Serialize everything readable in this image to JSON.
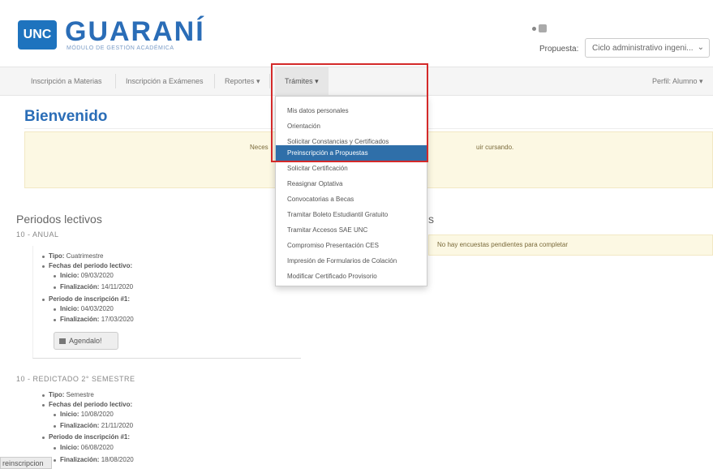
{
  "header": {
    "logo_badge": "UNC",
    "logo_title": "GUARANÍ",
    "logo_subtitle": "MÓDULO DE GESTIÓN ACADÉMICA",
    "propuesta_label": "Propuesta:",
    "propuesta_value": "Ciclo administrativo ingeni..."
  },
  "nav": {
    "items": [
      "Inscripción a Materias",
      "Inscripción a Exámenes",
      "Reportes ▾",
      "Trámites ▾"
    ],
    "profile": "Perfil: Alumno ▾"
  },
  "main": {
    "title": "Bienvenido",
    "notice_left": "Neces",
    "notice_right": "uir cursando."
  },
  "periodos": {
    "title": "Periodos lectivos",
    "p1": {
      "head": "10 - ANUAL",
      "tipo_label": "Tipo:",
      "tipo_value": "Cuatrimestre",
      "fechas_label": "Fechas del periodo lectivo:",
      "inicio_label": "Inicio:",
      "inicio_value": "09/03/2020",
      "fin_label": "Finalización:",
      "fin_value": "14/11/2020",
      "insc_label": "Periodo de inscripción #1:",
      "insc_inicio_label": "Inicio:",
      "insc_inicio_value": "04/03/2020",
      "insc_fin_label": "Finalización:",
      "insc_fin_value": "17/03/2020",
      "agendalo": "Agendalo!"
    },
    "p2": {
      "head": "10 - REDICTADO 2° SEMESTRE",
      "tipo_label": "Tipo:",
      "tipo_value": "Semestre",
      "fechas_label": "Fechas del periodo lectivo:",
      "inicio_label": "Inicio:",
      "inicio_value": "10/08/2020",
      "fin_label": "Finalización:",
      "fin_value": "21/11/2020",
      "insc_label": "Periodo de inscripción #1:",
      "insc_inicio_label": "Inicio:",
      "insc_inicio_value": "06/08/2020",
      "insc_fin_label": "Finalización:",
      "insc_fin_value": "18/08/2020"
    }
  },
  "encuestas": {
    "title_fragment": "s",
    "empty_message": "No hay encuestas pendientes para completar"
  },
  "dropdown": {
    "items": [
      "Mis datos personales",
      "Orientación",
      "Solicitar Constancias y Certificados",
      "Preinscripción a Propuestas",
      "Solicitar Certificación",
      "Reasignar Optativa",
      "Convocatorias a Becas",
      "Tramitar Boleto Estudiantil Gratuito",
      "Tramitar Accesos SAE UNC",
      "Compromiso Presentación CES",
      "Impresión de Formularios de Colación",
      "Modificar Certificado Provisorio"
    ],
    "selected_index": 3
  },
  "status_bar": {
    "tab_label": "reinscripcion"
  },
  "colors": {
    "brand_blue": "#2a6db7",
    "selected_bg": "#2f6fa9",
    "highlight_red": "#d42a2a",
    "notice_bg": "#fcf8e3"
  }
}
